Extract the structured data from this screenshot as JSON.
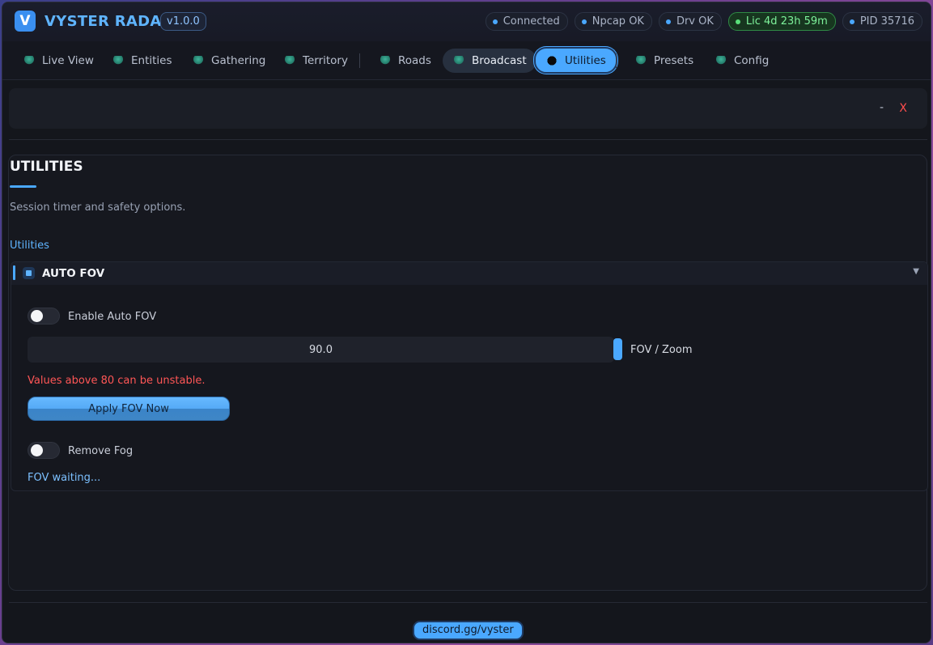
{
  "header": {
    "logo_letter": "V",
    "title": "VYSTER RADAR",
    "version": "v1.0.0",
    "status": [
      {
        "label": "Connected",
        "kind": "info"
      },
      {
        "label": "Npcap OK",
        "kind": "info"
      },
      {
        "label": "Drv OK",
        "kind": "info"
      },
      {
        "label": "Lic 4d 23h 59m",
        "kind": "success"
      },
      {
        "label": "PID 35716",
        "kind": "info"
      }
    ]
  },
  "nav": {
    "tabs": [
      {
        "label": "Live View"
      },
      {
        "label": "Entities"
      },
      {
        "label": "Gathering"
      },
      {
        "label": "Territory"
      },
      {
        "label": "Roads"
      },
      {
        "label": "Broadcast"
      },
      {
        "label": "Utilities",
        "active": true
      },
      {
        "label": "Presets"
      },
      {
        "label": "Config"
      }
    ]
  },
  "window_controls": {
    "minimize": "-",
    "close": "X"
  },
  "panel": {
    "title": "UTILITIES",
    "description": "Session timer and safety options.",
    "section_label": "Utilities",
    "accordion": {
      "title": "AUTO FOV",
      "enable_label": "Enable Auto FOV",
      "enable_on": false,
      "fov_value": "90.0",
      "fov_label": "FOV / Zoom",
      "warning": "Values above 80 can be unstable.",
      "apply_label": "Apply FOV Now",
      "fog_label": "Remove Fog",
      "fog_on": false,
      "status": "FOV waiting..."
    }
  },
  "footer": {
    "discord": "discord.gg/vyster"
  },
  "colors": {
    "accent": "#4aa8ff",
    "warning": "#ff5656",
    "success": "#59e07a",
    "background": "#14161c"
  }
}
